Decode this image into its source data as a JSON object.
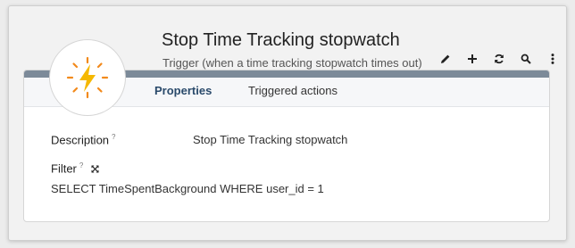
{
  "header": {
    "title": "Stop Time Tracking stopwatch",
    "subtitle": "Trigger (when a time tracking stopwatch times out)"
  },
  "toolbar": {
    "icons": [
      "pencil-icon",
      "plus-icon",
      "refresh-icon",
      "search-icon",
      "more-vertical-icon"
    ]
  },
  "tabs": [
    {
      "label": "Properties",
      "active": true
    },
    {
      "label": "Triggered actions",
      "active": false
    }
  ],
  "fields": {
    "description": {
      "label": "Description",
      "help": "?",
      "value": "Stop Time Tracking stopwatch"
    },
    "filter": {
      "label": "Filter",
      "help": "?",
      "value": "SELECT TimeSpentBackground WHERE user_id = 1"
    }
  },
  "colors": {
    "accent_bolt": "#f5b800",
    "accent_rays": "#f28a1c",
    "header_bar": "#7c8a99",
    "active_tab": "#2a4a6b"
  },
  "avatar_icon": "lightning-bolt-icon"
}
